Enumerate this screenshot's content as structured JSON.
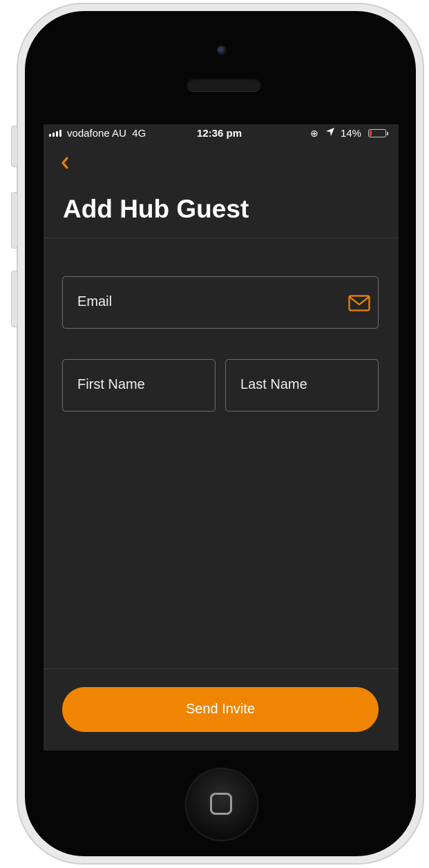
{
  "status_bar": {
    "carrier": "vodafone AU",
    "network": "4G",
    "time": "12:36 pm",
    "battery_percent": "14%",
    "battery_level": 0.14,
    "battery_color": "#ff3b30"
  },
  "nav": {
    "back_icon": "chevron-left-icon"
  },
  "page": {
    "title": "Add Hub Guest"
  },
  "form": {
    "email": {
      "placeholder": "Email",
      "value": "",
      "icon": "mail-icon"
    },
    "first_name": {
      "placeholder": "First Name",
      "value": ""
    },
    "last_name": {
      "placeholder": "Last Name",
      "value": ""
    }
  },
  "actions": {
    "send_label": "Send Invite"
  },
  "colors": {
    "accent": "#ef8503",
    "background": "#252525",
    "text": "#ffffff"
  }
}
